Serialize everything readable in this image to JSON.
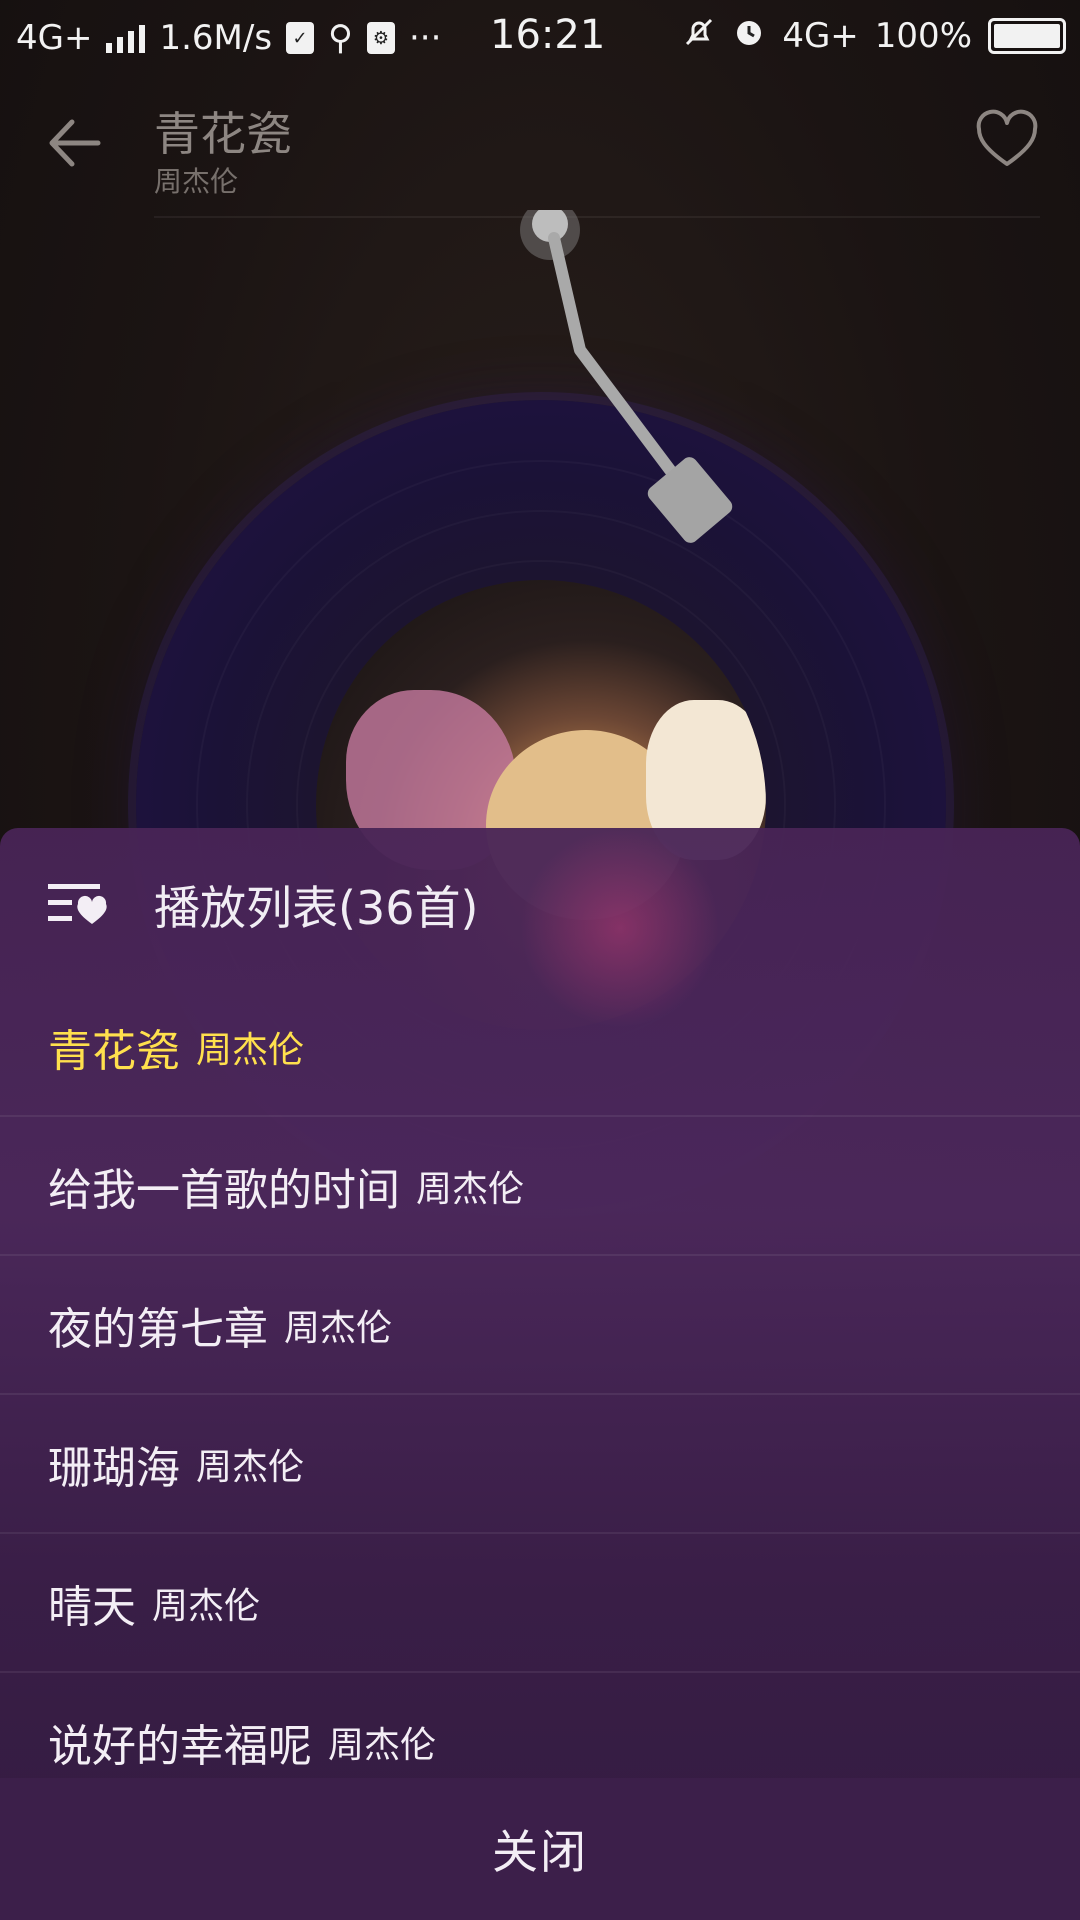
{
  "status_bar": {
    "network": "4G+",
    "speed": "1.6M/s",
    "more": "···",
    "time": "16:21",
    "network_right": "4G+",
    "battery": "100%"
  },
  "header": {
    "title": "青花瓷",
    "artist": "周杰伦"
  },
  "playlist": {
    "title": "播放列表(36首)",
    "items": [
      {
        "name": "青花瓷",
        "artist": "周杰伦",
        "current": true
      },
      {
        "name": "给我一首歌的时间",
        "artist": "周杰伦"
      },
      {
        "name": "夜的第七章",
        "artist": "周杰伦"
      },
      {
        "name": "珊瑚海",
        "artist": "周杰伦"
      },
      {
        "name": "晴天",
        "artist": "周杰伦"
      },
      {
        "name": "说好的幸福呢",
        "artist": "周杰伦"
      }
    ],
    "close_label": "关闭"
  },
  "colors": {
    "current_song": "#ffe04d",
    "sheet_bg": "#4a2558",
    "text": "#f3eef5"
  },
  "icons": {
    "back": "arrow-left-icon",
    "favorite": "heart-outline-icon",
    "playlist": "playlist-heart-icon"
  }
}
